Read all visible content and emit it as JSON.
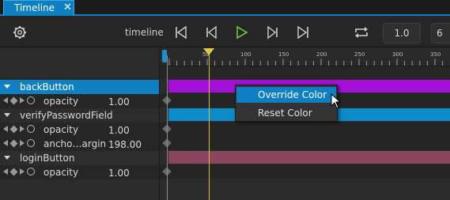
{
  "tab": {
    "title": "Timeline",
    "close": "✕"
  },
  "toolbar": {
    "settings_icon": "gear-icon",
    "timeline_label": "timeline",
    "transport": [
      "skip-to-start-icon",
      "step-back-icon",
      "play-icon",
      "step-forward-icon",
      "skip-to-end-icon"
    ],
    "loop_icon": "loop-icon",
    "speed_value": "1.0",
    "end_value": "6"
  },
  "ruler": {
    "ticks": [
      "0",
      "50",
      "100",
      "150",
      "200",
      "250",
      "300",
      "350",
      "400"
    ],
    "playhead_frame": 50
  },
  "tree": [
    {
      "type": "object",
      "name": "backButton",
      "selected": true
    },
    {
      "type": "property",
      "name": "opacity",
      "value": "1.00"
    },
    {
      "type": "object",
      "name": "verifyPasswordField",
      "selected": false
    },
    {
      "type": "property",
      "name": "opacity",
      "value": "1.00"
    },
    {
      "type": "property",
      "name": "ancho…argin",
      "value": "198.00"
    },
    {
      "type": "object",
      "name": "loginButton",
      "selected": false
    },
    {
      "type": "property",
      "name": "opacity",
      "value": "1.00"
    }
  ],
  "track_colors": {
    "backButton": "#a40fd8",
    "verifyPasswordField": "#0f8ac8",
    "loginButton": "#8a4560"
  },
  "context_menu": {
    "items": [
      {
        "label": "Override Color",
        "hovered": true
      },
      {
        "label": "Reset Color",
        "hovered": false
      }
    ]
  },
  "colors": {
    "accent": "#0e7fc0",
    "playhead": "#e0cc3c",
    "play": "#6cc24a"
  }
}
